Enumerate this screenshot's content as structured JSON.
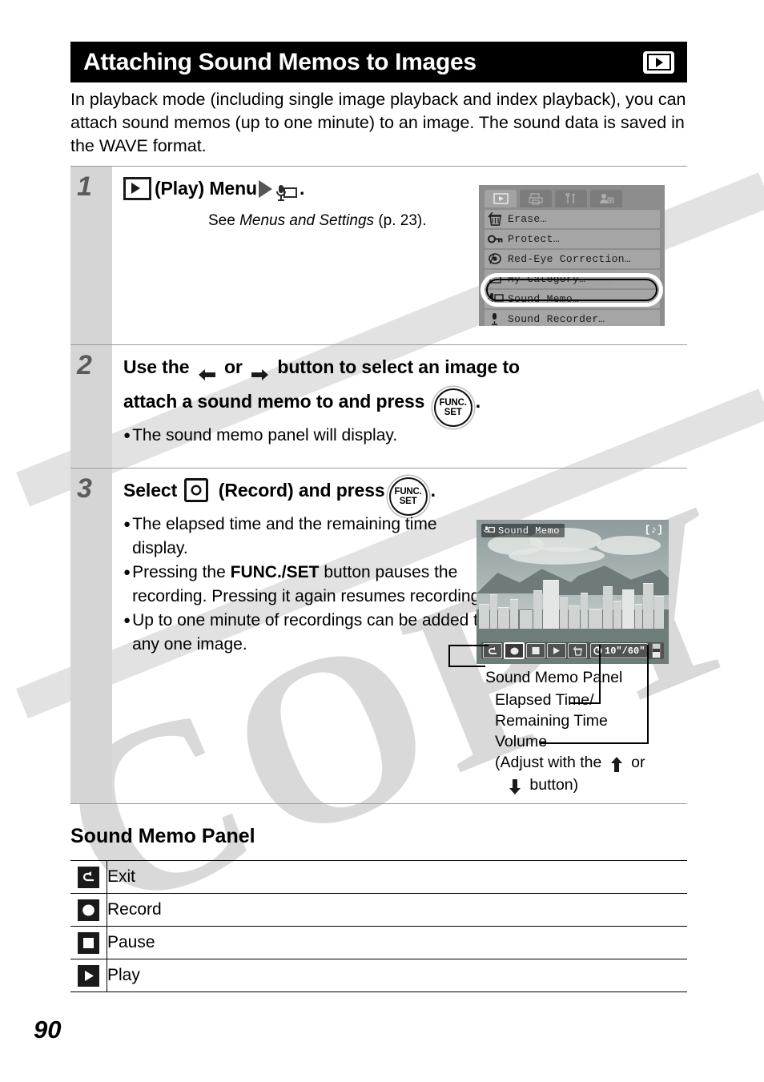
{
  "page": {
    "number": "90",
    "title": "Attaching Sound Memos to Images",
    "title_icon": "play-mode-icon",
    "intro": "In playback mode (including single image playback and index playback), you can attach sound memos (up to one minute) to an image. The sound data is saved in the WAVE format."
  },
  "steps": [
    {
      "number": "1",
      "heading_prefix": "",
      "heading_play_label": "(Play) Menu",
      "heading_suffix": ".",
      "note_prefix": "See ",
      "note_italic": "Menus and Settings",
      "note_suffix": " (p. 23)."
    },
    {
      "number": "2",
      "line1_a": "Use the",
      "line1_b": "or",
      "line1_c": "button to select an image to",
      "line2_a": "attach a sound memo to and press",
      "line2_b": ".",
      "bullets": [
        "The sound memo panel will display."
      ]
    },
    {
      "number": "3",
      "heading_a": "Select",
      "heading_b": "(Record) and press",
      "heading_c": ".",
      "bullets": [
        {
          "text": "The elapsed time and the remaining time display."
        },
        {
          "pre": "Pressing the ",
          "bold": "FUNC./SET",
          "post": " button pauses the recording. Pressing it again resumes recording."
        },
        {
          "text": "Up to one minute of recordings can be added to any one image."
        }
      ]
    }
  ],
  "lcd_menu": {
    "tabs": [
      {
        "name": "play-tab",
        "active": true
      },
      {
        "name": "print-tab",
        "active": false
      },
      {
        "name": "setup-tab",
        "active": false
      },
      {
        "name": "my-camera-tab",
        "active": false
      }
    ],
    "items": [
      {
        "label": "Erase…",
        "icon": "trash-icon"
      },
      {
        "label": "Protect…",
        "icon": "key-icon"
      },
      {
        "label": "Red-Eye Correction…",
        "icon": "red-eye-icon"
      },
      {
        "label": "My Category…",
        "icon": "category-icon",
        "obscured": true
      },
      {
        "label": "Sound Memo…",
        "icon": "sound-memo-icon",
        "highlighted": true
      },
      {
        "label": "Sound Recorder…",
        "icon": "sound-recorder-icon",
        "obscured": true
      }
    ]
  },
  "lcd_memo": {
    "title": "Sound Memo",
    "title_icon": "sound-memo-icon",
    "corner_icon": "music-note-icon",
    "controls": [
      {
        "name": "exit-button",
        "icon": "back-arrow-icon",
        "selected": false
      },
      {
        "name": "record-button",
        "icon": "record-circle-icon",
        "selected": true
      },
      {
        "name": "pause-button",
        "icon": "stop-square-icon",
        "selected": false
      },
      {
        "name": "play-button",
        "icon": "play-triangle-icon",
        "selected": false
      },
      {
        "name": "erase-button",
        "icon": "trash-icon",
        "selected": false
      }
    ],
    "time": "10\"/60\"",
    "time_icon": "clock-icon",
    "volume_icon": "volume-slider-icon"
  },
  "callouts": {
    "panel": "Sound Memo Panel",
    "time_line1": "Elapsed Time/",
    "time_line2": "Remaining Time",
    "volume": "Volume",
    "volume_note_a": "(Adjust with the",
    "volume_note_b": "or",
    "volume_note_c": "button)"
  },
  "sound_memo_panel": {
    "section_title": "Sound Memo Panel",
    "rows": [
      {
        "icon": "exit-icon",
        "label": "Exit"
      },
      {
        "icon": "record-icon",
        "label": "Record"
      },
      {
        "icon": "pause-icon",
        "label": "Pause"
      },
      {
        "icon": "play-icon",
        "label": "Play"
      }
    ]
  },
  "colors": {
    "title_bar": "#000000",
    "step_number_column": "#d5d5d5",
    "step_number_text": "#5b5b5b",
    "rule": "#9a9a9a",
    "watermark": "#d9d9d9"
  }
}
